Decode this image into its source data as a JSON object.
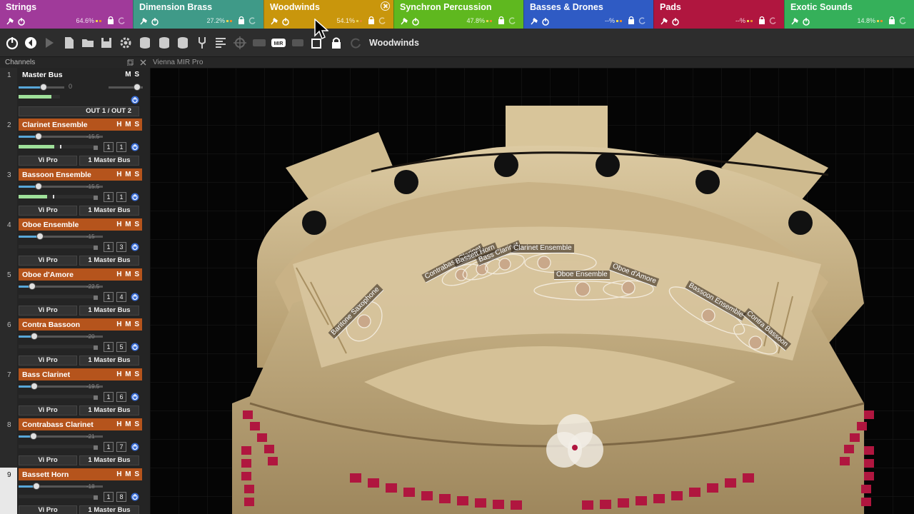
{
  "tabs": [
    {
      "name": "Strings",
      "pct": "64.6%",
      "color": "#a03a9a"
    },
    {
      "name": "Dimension Brass",
      "pct": "27.2%",
      "color": "#3f9a88"
    },
    {
      "name": "Woodwinds",
      "pct": "54.1%",
      "color": "#c9960c",
      "active": true
    },
    {
      "name": "Synchron Percussion",
      "pct": "47.8%",
      "color": "#5fb81f"
    },
    {
      "name": "Basses & Drones",
      "pct": "--%",
      "color": "#2f5bc4"
    },
    {
      "name": "Pads",
      "pct": "--%",
      "color": "#b0163f"
    },
    {
      "name": "Exotic Sounds",
      "pct": "14.8%",
      "color": "#35b05a"
    }
  ],
  "toolbar": {
    "title": "Woodwinds"
  },
  "channels_panel": {
    "title": "Channels"
  },
  "mir_panel": {
    "title": "Vienna MIR Pro"
  },
  "master": {
    "num": "1",
    "name": "Master Bus",
    "ms": "M S",
    "value": "0",
    "route": "OUT 1 / OUT 2",
    "volume": 0.55
  },
  "channels": [
    {
      "num": "2",
      "name": "Clarinet Ensemble",
      "hms": "H M S",
      "db": "-15.5",
      "a": "1",
      "b": "1",
      "src": "Vi Pro",
      "dst": "1 Master Bus",
      "volume": 0.24,
      "level": 0.45
    },
    {
      "num": "3",
      "name": "Bassoon Ensemble",
      "hms": "H M S",
      "db": "-15.5",
      "a": "1",
      "b": "1",
      "src": "Vi Pro",
      "dst": "1 Master Bus",
      "volume": 0.24,
      "level": 0.36
    },
    {
      "num": "4",
      "name": "Oboe Ensemble",
      "hms": "H M S",
      "db": "-15",
      "a": "1",
      "b": "3",
      "src": "Vi Pro",
      "dst": "1 Master Bus",
      "volume": 0.25,
      "level": 0
    },
    {
      "num": "5",
      "name": "Oboe d'Amore",
      "hms": "H M S",
      "db": "-22.5",
      "a": "1",
      "b": "4",
      "src": "Vi Pro",
      "dst": "1 Master Bus",
      "volume": 0.16,
      "level": 0
    },
    {
      "num": "6",
      "name": "Contra Bassoon",
      "hms": "H M S",
      "db": "-20",
      "a": "1",
      "b": "5",
      "src": "Vi Pro",
      "dst": "1 Master Bus",
      "volume": 0.19,
      "level": 0
    },
    {
      "num": "7",
      "name": "Bass Clarinet",
      "hms": "H M S",
      "db": "-19.5",
      "a": "1",
      "b": "6",
      "src": "Vi Pro",
      "dst": "1 Master Bus",
      "volume": 0.19,
      "level": 0
    },
    {
      "num": "8",
      "name": "Contrabass Clarinet",
      "hms": "H M S",
      "db": "-21",
      "a": "1",
      "b": "7",
      "src": "Vi Pro",
      "dst": "1 Master Bus",
      "volume": 0.18,
      "level": 0
    },
    {
      "num": "9",
      "name": "Bassett Horn",
      "hms": "H M S",
      "db": "-18",
      "a": "1",
      "b": "8",
      "src": "Vi Pro",
      "dst": "1 Master Bus",
      "volume": 0.21,
      "level": 0,
      "highlight": true
    }
  ],
  "stage_labels": {
    "baritone_sax": "Baritone Saxophone",
    "contrabass_clarinet": "Contrabass Clarinet",
    "bassett_horn": "Bassett Horn",
    "bass_clarinet": "Bass Clarinet",
    "clarinet_ensemble": "Clarinet Ensemble",
    "oboe_ensemble": "Oboe Ensemble",
    "oboe_damore": "Oboe d'Amore",
    "bassoon_ensemble": "Bassoon Ensemble",
    "contra_bassoon": "Contra Bassoon"
  },
  "colors": {
    "instrument_header": "#b5541c",
    "volume_fill": "#58a7d9",
    "level_meter": "#9fe09a",
    "seat": "#b0163f"
  }
}
